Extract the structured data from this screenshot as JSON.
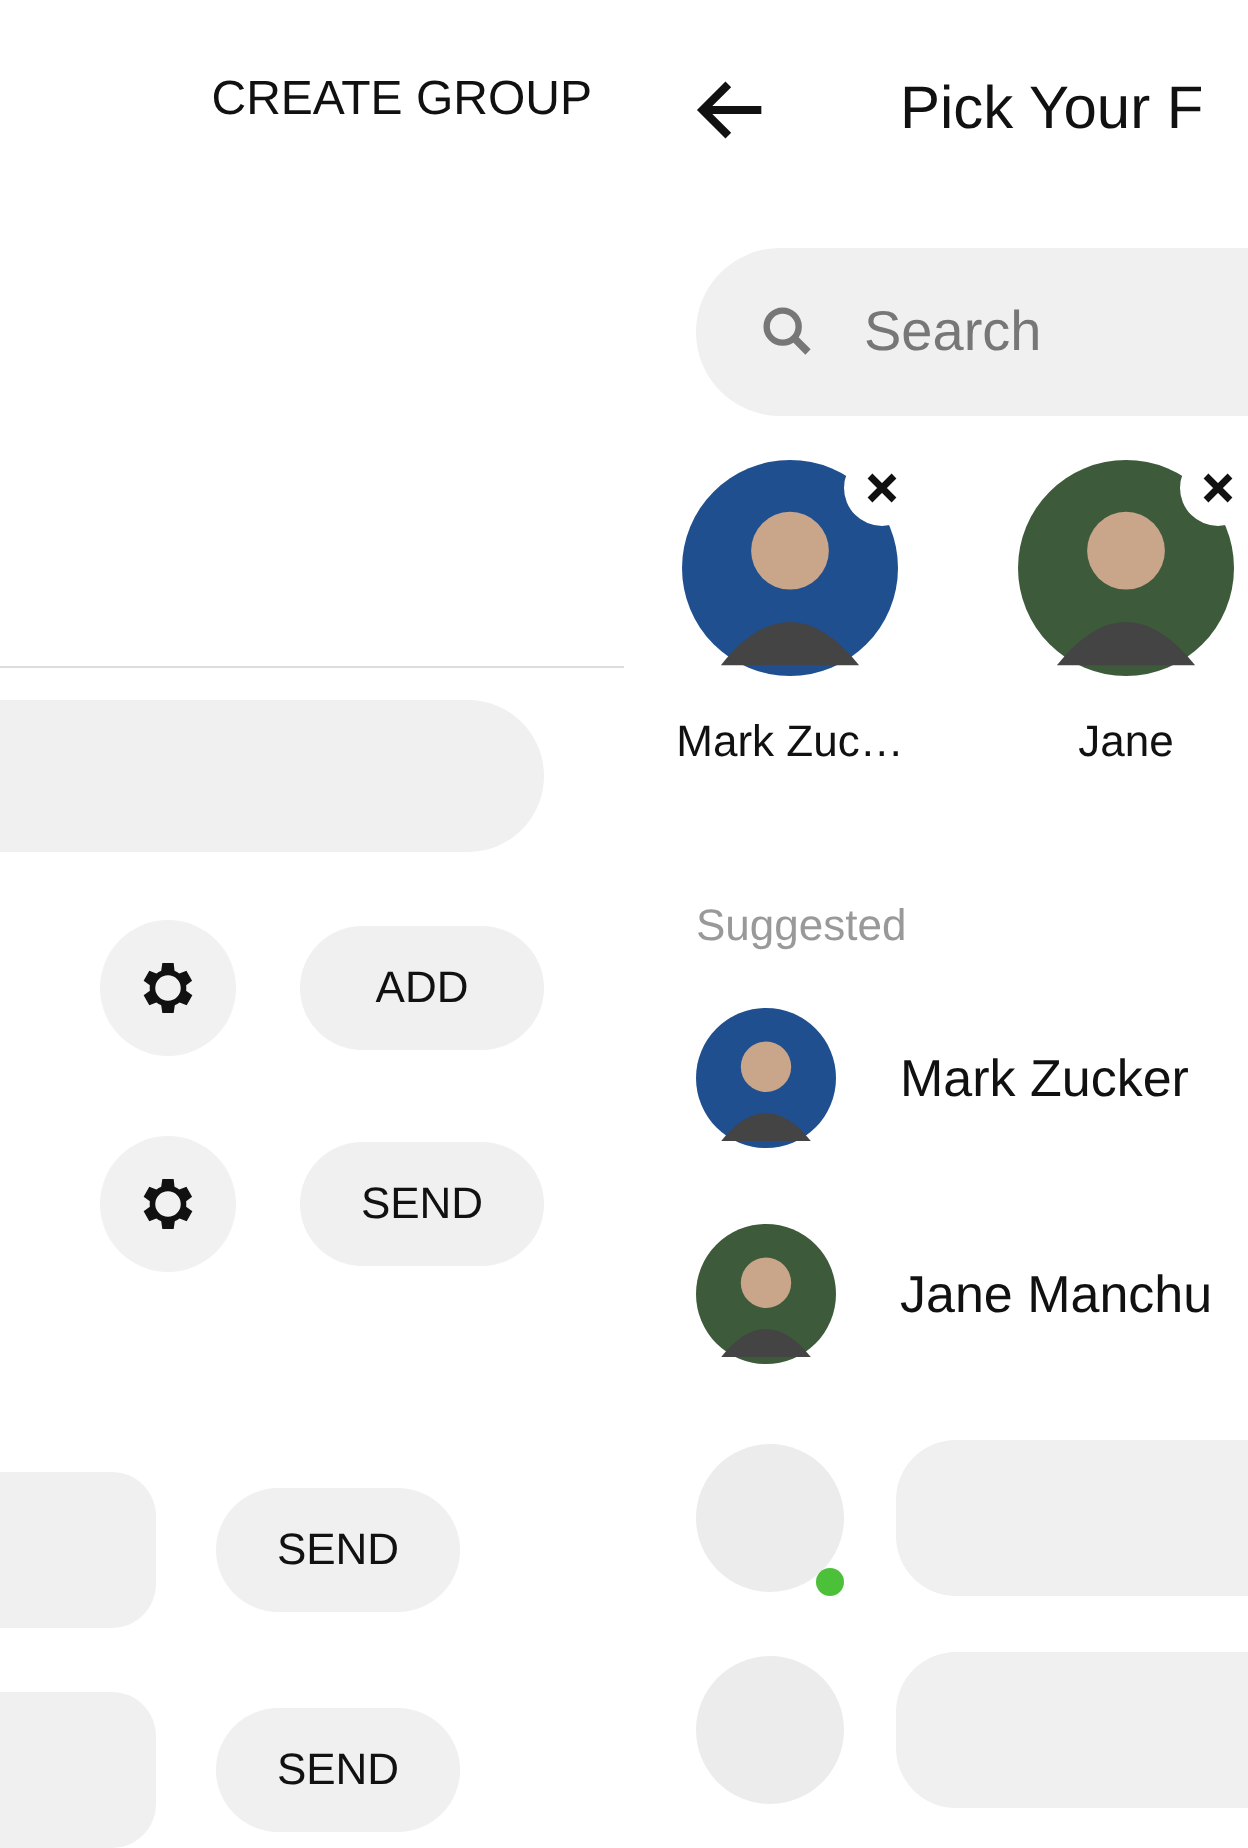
{
  "left_panel": {
    "action": "CREATE GROUP",
    "setting_rows": [
      {
        "button": "ADD"
      },
      {
        "button": "SEND"
      }
    ],
    "send_rows": [
      {
        "button": "SEND"
      },
      {
        "button": "SEND"
      }
    ]
  },
  "right_panel": {
    "title": "Pick Your F",
    "search": {
      "placeholder": "Search"
    },
    "picked": [
      {
        "name": "Mark Zuc…",
        "color": "#1f4f8f"
      },
      {
        "name": "Jane",
        "color": "#3d5a3a"
      }
    ],
    "section": "Suggested",
    "suggested": [
      {
        "name": "Mark Zucker",
        "color": "#1f4f8f"
      },
      {
        "name": "Jane Manchu",
        "color": "#3d5a3a"
      }
    ],
    "loading_rows": [
      {
        "online": true
      },
      {
        "online": false
      }
    ]
  }
}
